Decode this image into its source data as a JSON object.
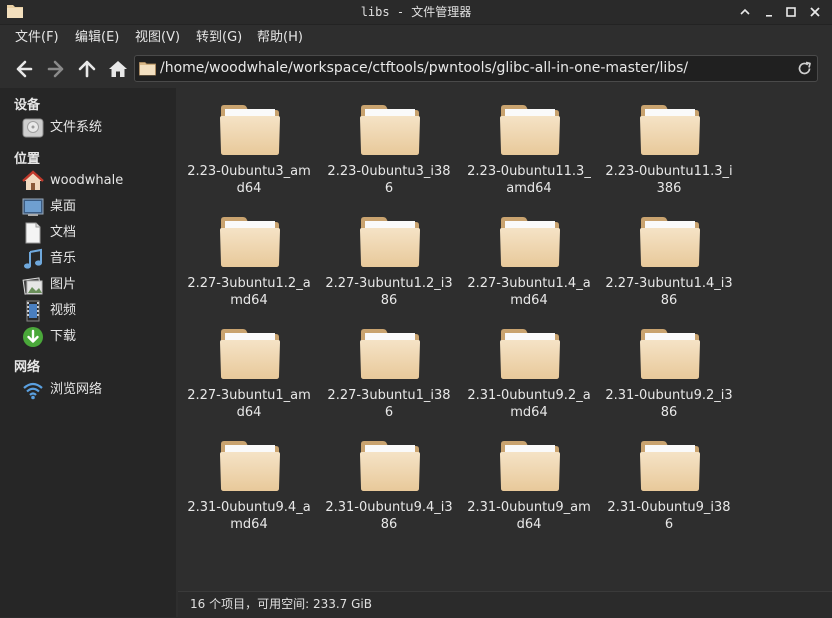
{
  "window": {
    "title": "libs - 文件管理器",
    "controls": [
      "minimize",
      "restore",
      "maximize",
      "close"
    ]
  },
  "menubar": {
    "items": [
      "文件(F)",
      "编辑(E)",
      "视图(V)",
      "转到(G)",
      "帮助(H)"
    ]
  },
  "toolbar": {
    "back_icon": "arrow-left-icon",
    "forward_icon": "arrow-right-icon",
    "up_icon": "arrow-up-icon",
    "home_icon": "home-icon",
    "path": "/home/woodwhale/workspace/ctftools/pwntools/glibc-all-in-one-master/libs/",
    "reload_icon": "reload-icon"
  },
  "sidebar": {
    "sections": [
      {
        "title": "设备",
        "items": [
          {
            "label": "文件系统",
            "icon": "drive-icon"
          }
        ]
      },
      {
        "title": "位置",
        "items": [
          {
            "label": "woodwhale",
            "icon": "home-icon"
          },
          {
            "label": "桌面",
            "icon": "desktop-icon"
          },
          {
            "label": "文档",
            "icon": "document-icon"
          },
          {
            "label": "音乐",
            "icon": "music-icon"
          },
          {
            "label": "图片",
            "icon": "picture-icon"
          },
          {
            "label": "视频",
            "icon": "video-icon"
          },
          {
            "label": "下载",
            "icon": "download-icon"
          }
        ]
      },
      {
        "title": "网络",
        "items": [
          {
            "label": "浏览网络",
            "icon": "network-icon"
          }
        ]
      }
    ]
  },
  "files": [
    {
      "line1": "2.23-0ubuntu3_am",
      "line2": "d64"
    },
    {
      "line1": "2.23-0ubuntu3_i38",
      "line2": "6"
    },
    {
      "line1": "2.23-0ubuntu11.3_",
      "line2": "amd64"
    },
    {
      "line1": "2.23-0ubuntu11.3_i",
      "line2": "386"
    },
    {
      "line1": "2.27-3ubuntu1.2_a",
      "line2": "md64"
    },
    {
      "line1": "2.27-3ubuntu1.2_i3",
      "line2": "86"
    },
    {
      "line1": "2.27-3ubuntu1.4_a",
      "line2": "md64"
    },
    {
      "line1": "2.27-3ubuntu1.4_i3",
      "line2": "86"
    },
    {
      "line1": "2.27-3ubuntu1_am",
      "line2": "d64"
    },
    {
      "line1": "2.27-3ubuntu1_i38",
      "line2": "6"
    },
    {
      "line1": "2.31-0ubuntu9.2_a",
      "line2": "md64"
    },
    {
      "line1": "2.31-0ubuntu9.2_i3",
      "line2": "86"
    },
    {
      "line1": "2.31-0ubuntu9.4_a",
      "line2": "md64"
    },
    {
      "line1": "2.31-0ubuntu9.4_i3",
      "line2": "86"
    },
    {
      "line1": "2.31-0ubuntu9_am",
      "line2": "d64"
    },
    {
      "line1": "2.31-0ubuntu9_i38",
      "line2": "6"
    }
  ],
  "status": {
    "text": "16 个项目，可用空间: 233.7 GiB"
  },
  "colors": {
    "folder_light": "#f5e3c6",
    "folder_dark": "#e8c99a",
    "background": "#2e2e2e",
    "sidebar": "#262626"
  }
}
